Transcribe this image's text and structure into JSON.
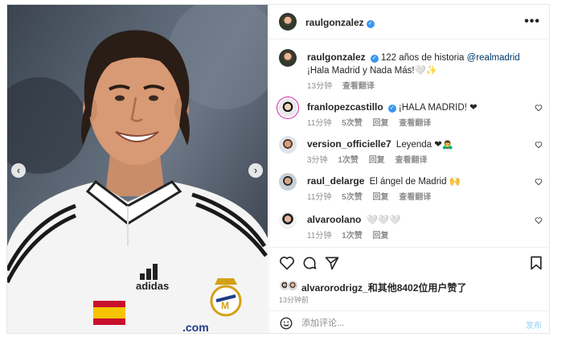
{
  "header": {
    "username": "raulgonzalez",
    "verified_icon": "verified-badge-icon",
    "more_icon": "more-options-icon"
  },
  "caption": {
    "username": "raulgonzalez",
    "text_before": " 122 años de historia ",
    "mention": "@realmadrid",
    "text_after": " ¡Hala Madrid y Nada Más!🤍✨",
    "time": "13分钟",
    "translate": "查看翻译"
  },
  "comments": [
    {
      "username": "franlopezcastillo",
      "verified": true,
      "text": " ¡HALA MADRID! ❤",
      "time": "11分钟",
      "likes": "5次赞",
      "reply": "回复",
      "translate": "查看翻译"
    },
    {
      "username": "version_officielle7",
      "verified": false,
      "text": "Leyenda ❤🙇‍♂️",
      "time": "3分钟",
      "likes": "1次赞",
      "reply": "回复",
      "translate": "查看翻译"
    },
    {
      "username": "raul_delarge",
      "verified": false,
      "text": "El ángel de Madrid 🙌",
      "time": "11分钟",
      "likes": "5次赞",
      "reply": "回复",
      "translate": "查看翻译"
    },
    {
      "username": "alvaroolano",
      "verified": false,
      "text": "🤍🤍🤍",
      "time": "11分钟",
      "likes": "1次赞",
      "reply": "回复",
      "translate": ""
    }
  ],
  "actions": {
    "like_icon": "heart-outline-icon",
    "comment_icon": "comment-bubble-icon",
    "share_icon": "paper-plane-icon",
    "save_icon": "bookmark-icon"
  },
  "likes": {
    "text": "alvarorodrigz_和其他8402位用户赞了"
  },
  "post_time": "13分钟前",
  "comment_bar": {
    "placeholder": "添加评论...",
    "post_label": "发布",
    "emoji_icon": "emoji-smile-icon"
  },
  "photo": {
    "nav_prev": "‹",
    "nav_next": "›",
    "jersey_brand": "adidas",
    "jersey_sponsor": ".com",
    "flag": "Spain",
    "crest": "Real Madrid"
  },
  "colors": {
    "verified": "#3897f0",
    "mention": "#00376b",
    "muted": "#8e8e8e",
    "post_button": "#b2dffc"
  }
}
